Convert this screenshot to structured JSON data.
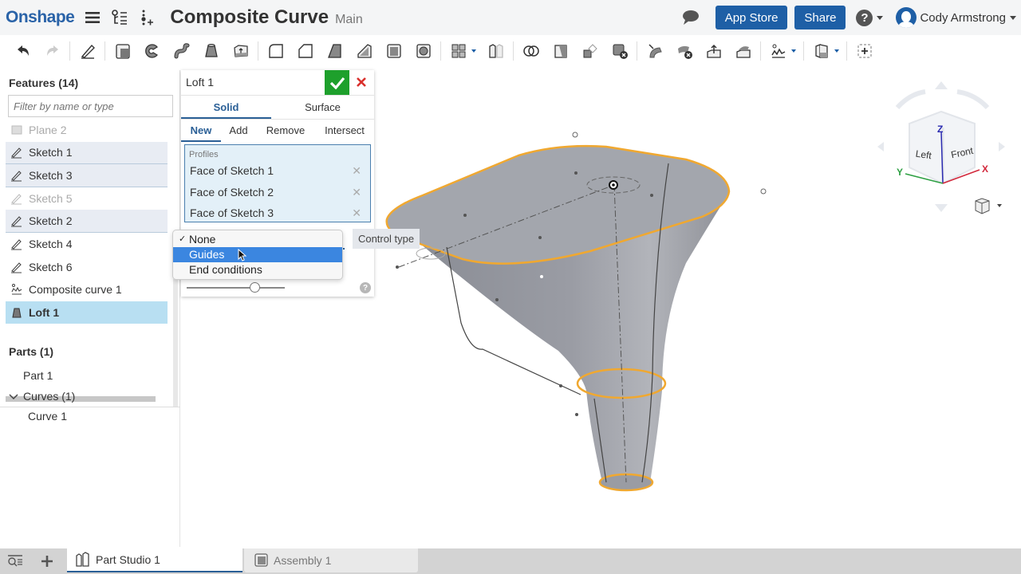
{
  "header": {
    "logo": "Onshape",
    "doc_title": "Composite Curve",
    "branch": "Main",
    "app_store_label": "App Store",
    "share_label": "Share",
    "user_name": "Cody Armstrong",
    "help_icon": "question-circle-icon",
    "chat_icon": "comment-icon"
  },
  "toolbar": {
    "tools": [
      "undo",
      "redo",
      "sketch",
      "extrude",
      "revolve",
      "sweep",
      "loft",
      "thicken",
      "fillet",
      "chamfer",
      "draft",
      "rib",
      "shell",
      "hole",
      "linear-pattern",
      "mirror",
      "boolean",
      "split",
      "transform",
      "delete-part",
      "modify-fillet",
      "delete-face",
      "move-face",
      "replace-face",
      "curve-tools",
      "plane",
      "add-custom-feature"
    ]
  },
  "features_panel": {
    "title": "Features (14)",
    "filter_placeholder": "Filter by name or type",
    "items": [
      {
        "label": "Plane 2",
        "icon": "plane-icon",
        "state": "dim"
      },
      {
        "label": "Sketch 1",
        "icon": "pencil-icon",
        "state": "highlighted"
      },
      {
        "label": "Sketch 3",
        "icon": "pencil-icon",
        "state": "highlighted"
      },
      {
        "label": "Sketch 5",
        "icon": "pencil-icon",
        "state": "dim"
      },
      {
        "label": "Sketch 2",
        "icon": "pencil-icon",
        "state": "highlighted"
      },
      {
        "label": "Sketch 4",
        "icon": "pencil-icon",
        "state": "normal"
      },
      {
        "label": "Sketch 6",
        "icon": "pencil-icon",
        "state": "normal"
      },
      {
        "label": "Composite curve 1",
        "icon": "composite-curve-icon",
        "state": "normal"
      },
      {
        "label": "Loft 1",
        "icon": "loft-icon",
        "state": "selected"
      }
    ]
  },
  "parts_panel": {
    "title": "Parts (1)",
    "items": [
      "Part 1"
    ],
    "curves_group": "Curves (1)",
    "curves": [
      "Curve 1"
    ]
  },
  "loft_dialog": {
    "title": "Loft 1",
    "body_tabs": [
      "Solid",
      "Surface"
    ],
    "active_body_tab": "Solid",
    "op_tabs": [
      "New",
      "Add",
      "Remove",
      "Intersect"
    ],
    "active_op_tab": "New",
    "profiles_label": "Profiles",
    "profiles": [
      "Face of Sketch 1",
      "Face of Sketch 2",
      "Face of Sketch 3"
    ],
    "slider_value": 0.7
  },
  "control_type_dropdown": {
    "options": [
      "None",
      "Guides",
      "End conditions"
    ],
    "checked": "None",
    "hovered": "Guides",
    "tooltip": "Control type"
  },
  "view_cube": {
    "faces": [
      "Left",
      "Front"
    ],
    "axes": [
      "X",
      "Y",
      "Z"
    ],
    "colors": {
      "x": "#d2283c",
      "y": "#2ea043",
      "z": "#2a2ab0"
    }
  },
  "bottom_tabs": [
    {
      "label": "Part Studio 1",
      "active": true
    },
    {
      "label": "Assembly 1",
      "active": false
    }
  ],
  "colors": {
    "brand": "#2a63a8",
    "button": "#1e5fa6",
    "ok": "#1ea02c",
    "cancel": "#d9302c",
    "edge_highlight": "#f0a830",
    "selected_row": "#b8dff2"
  }
}
